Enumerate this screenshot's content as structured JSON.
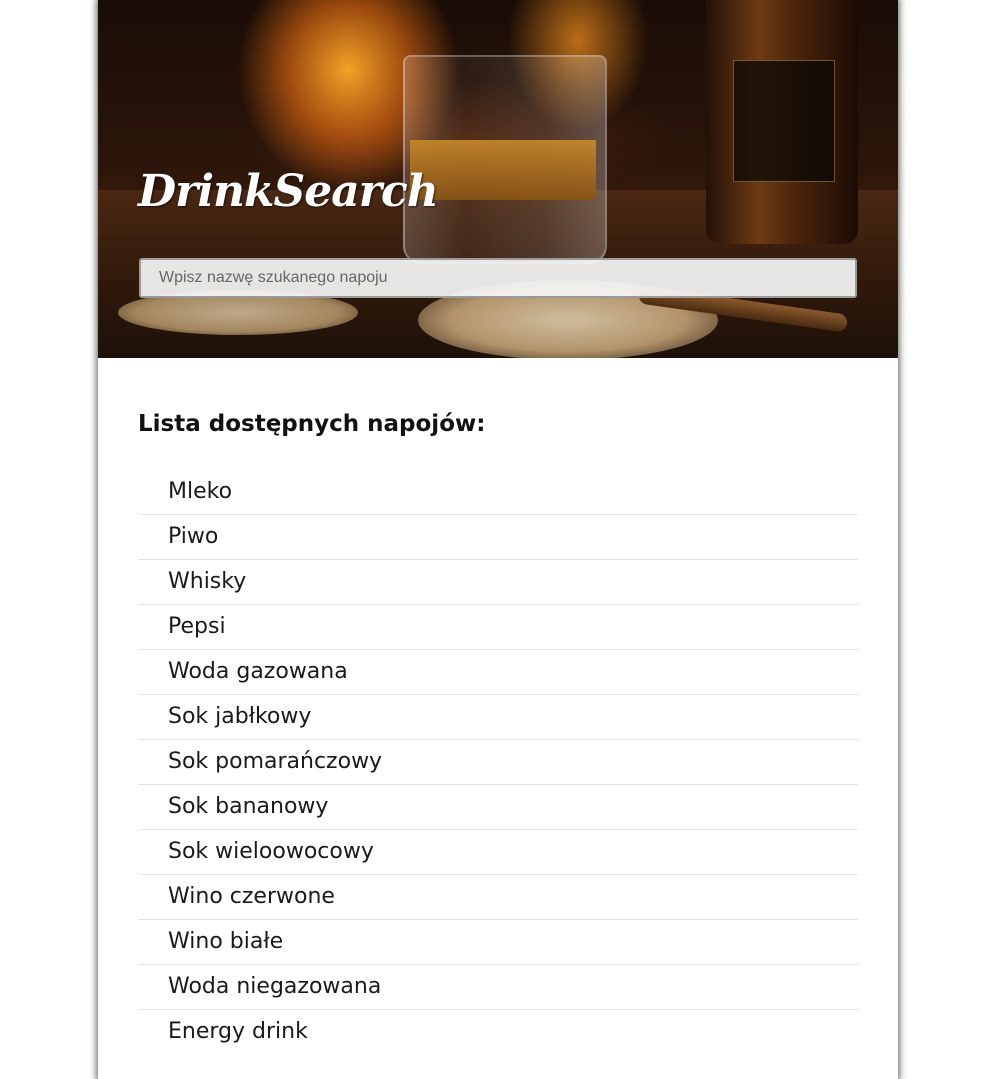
{
  "app": {
    "logo": "DrinkSearch"
  },
  "search": {
    "placeholder": "Wpisz nazwę szukanego napoju",
    "value": ""
  },
  "list": {
    "heading": "Lista dostępnych napojów:",
    "items": [
      "Mleko",
      "Piwo",
      "Whisky",
      "Pepsi",
      "Woda gazowana",
      "Sok jabłkowy",
      "Sok pomarańczowy",
      "Sok bananowy",
      "Sok wieloowocowy",
      "Wino czerwone",
      "Wino białe",
      "Woda niegazowana",
      "Energy drink"
    ]
  }
}
